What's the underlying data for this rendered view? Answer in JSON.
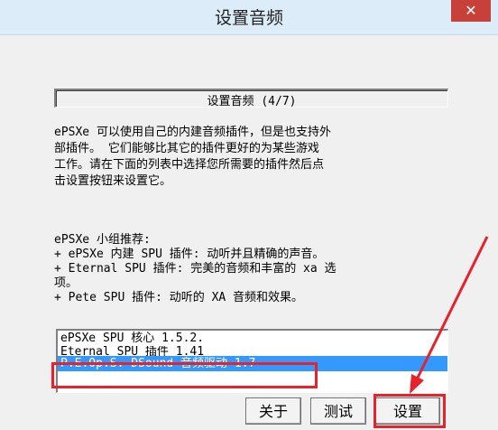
{
  "window": {
    "title": "设置音频",
    "close_label": "✕"
  },
  "step": {
    "label": "设置音频 (4/7)"
  },
  "description": {
    "lines": [
      "ePSXe 可以使用自己的内建音频插件，但是也支持外",
      "部插件。 它们能够比其它的插件更好的为某些游戏",
      "工作。请在下面的列表中选择您所需要的插件然后点",
      "击设置按钮来设置它。"
    ]
  },
  "recommend": {
    "lines": [
      "ePSXe 小组推荐:",
      "+ ePSXe 内建 SPU 插件: 动听并且精确的声音。",
      "+ Eternal SPU 插件: 完美的音频和丰富的 xa 选",
      "项。",
      "+ Pete SPU 插件: 动听的 XA 音频和效果。"
    ]
  },
  "plugins": {
    "items": [
      "ePSXe SPU 核心 1.5.2.",
      "Eternal SPU 插件 1.41",
      "P.E.Op.S. DSound 音频驱动 1.7"
    ],
    "selected_index": 2
  },
  "buttons": {
    "about": "关于",
    "test": "测试",
    "settings": "设置"
  },
  "annotation_color": "#e8222a"
}
